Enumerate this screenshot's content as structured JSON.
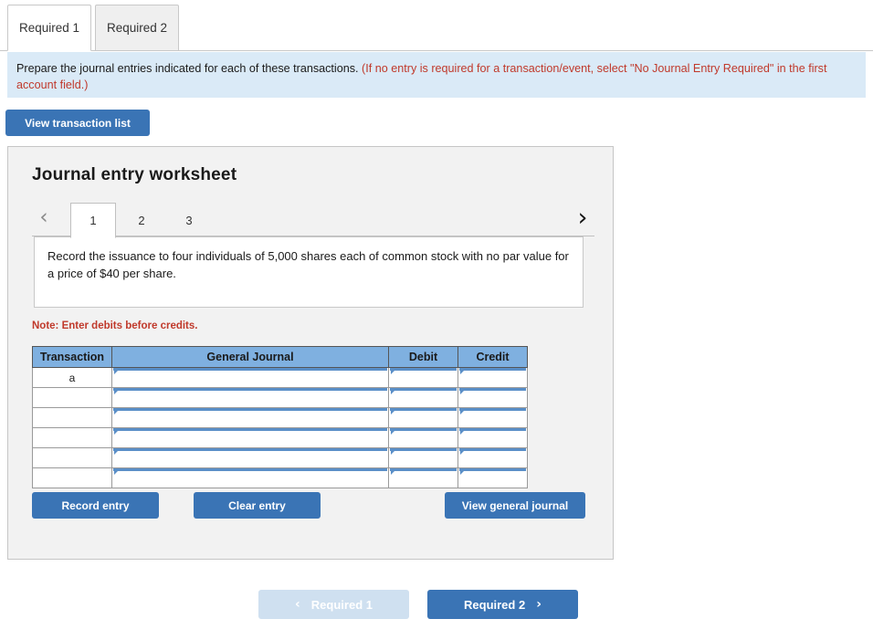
{
  "tabs": [
    {
      "label": "Required 1",
      "active": true
    },
    {
      "label": "Required 2",
      "active": false
    }
  ],
  "banner": {
    "instruction": "Prepare the journal entries indicated for each of these transactions.",
    "hint": "(If no entry is required for a transaction/event, select \"No Journal Entry Required\" in the first account field.)"
  },
  "toolbar": {
    "view_transaction_list_label": "View transaction list"
  },
  "worksheet": {
    "title": "Journal entry worksheet",
    "pages": [
      "1",
      "2",
      "3"
    ],
    "active_page": "1",
    "prev_icon": "chevron-left-icon",
    "next_icon": "chevron-right-icon",
    "description": "Record the issuance to four individuals of 5,000 shares each of common stock with no par value for a price of $40 per share.",
    "note": "Note: Enter debits before credits.",
    "table": {
      "headers": [
        "Transaction",
        "General Journal",
        "Debit",
        "Credit"
      ],
      "rows": [
        {
          "transaction": "a",
          "general_journal": "",
          "debit": "",
          "credit": ""
        },
        {
          "transaction": "",
          "general_journal": "",
          "debit": "",
          "credit": ""
        },
        {
          "transaction": "",
          "general_journal": "",
          "debit": "",
          "credit": ""
        },
        {
          "transaction": "",
          "general_journal": "",
          "debit": "",
          "credit": ""
        },
        {
          "transaction": "",
          "general_journal": "",
          "debit": "",
          "credit": ""
        },
        {
          "transaction": "",
          "general_journal": "",
          "debit": "",
          "credit": ""
        }
      ]
    },
    "actions": {
      "record_entry_label": "Record entry",
      "clear_entry_label": "Clear entry",
      "view_general_journal_label": "View general journal"
    }
  },
  "footer_nav": {
    "prev_label": "Required 1",
    "prev_icon": "chevron-left-icon",
    "prev_disabled": true,
    "next_label": "Required 2",
    "next_icon": "chevron-right-icon"
  },
  "colors": {
    "primary_blue": "#3a74b5",
    "disabled_blue": "#cfe0f0",
    "banner_blue": "#daeaf7",
    "table_header_blue": "#7fb0e0",
    "alert_red": "#c0392b",
    "panel_gray": "#f2f2f2"
  }
}
